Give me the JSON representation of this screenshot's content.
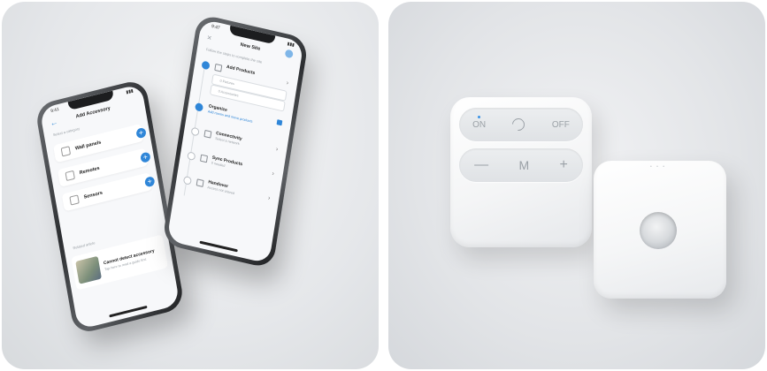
{
  "phone_left": {
    "status_time": "9:41",
    "title": "Add Accessory",
    "subtitle": "Select a category",
    "items": [
      {
        "label": "Wall panels",
        "icon": "wall-panel-icon"
      },
      {
        "label": "Remotes",
        "icon": "remote-icon"
      },
      {
        "label": "Sensors",
        "icon": "sensor-icon"
      }
    ],
    "section_label": "Related article",
    "detect_title": "Cannot detect accessory",
    "detect_sub": "Tap here to read a guide first"
  },
  "phone_right": {
    "status_time": "9:47",
    "title": "New Site",
    "subtitle": "Follow the steps to complete the site",
    "steps": [
      {
        "title": "Add Products",
        "sub": "",
        "done": true,
        "sub_items": [
          "0 Fixtures",
          "0 Accessories"
        ]
      },
      {
        "title": "Organize",
        "sub": "Add rooms and move products",
        "done": true
      },
      {
        "title": "Connectivity",
        "sub": "Select a network",
        "done": false
      },
      {
        "title": "Sync Products",
        "sub": "0 needed",
        "done": false
      },
      {
        "title": "Handover",
        "sub": "Access not shared",
        "done": false
      }
    ]
  },
  "remote": {
    "top_buttons": [
      "ON",
      "OFF"
    ],
    "bottom_buttons": [
      "—",
      "M",
      "+"
    ],
    "indicator_color": "#3b93e6"
  },
  "colors": {
    "accent": "#2f86d8",
    "panel_bg": "#e5e7ea"
  }
}
